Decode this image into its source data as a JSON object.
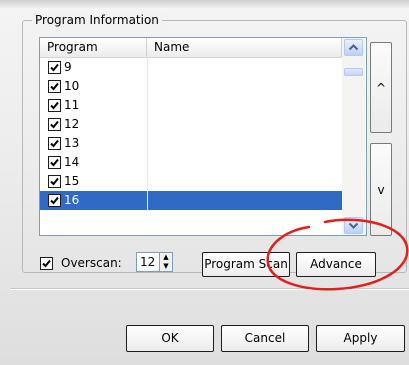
{
  "group": {
    "title": "Program Information"
  },
  "list": {
    "columns": [
      "Program",
      "Name"
    ],
    "rows": [
      {
        "program": "9",
        "name": "",
        "checked": true,
        "selected": false
      },
      {
        "program": "10",
        "name": "",
        "checked": true,
        "selected": false
      },
      {
        "program": "11",
        "name": "",
        "checked": true,
        "selected": false
      },
      {
        "program": "12",
        "name": "",
        "checked": true,
        "selected": false
      },
      {
        "program": "13",
        "name": "",
        "checked": true,
        "selected": false
      },
      {
        "program": "14",
        "name": "",
        "checked": true,
        "selected": false
      },
      {
        "program": "15",
        "name": "",
        "checked": true,
        "selected": false
      },
      {
        "program": "16",
        "name": "",
        "checked": true,
        "selected": true
      }
    ]
  },
  "side_buttons": {
    "up_label": "^",
    "down_label": "v"
  },
  "overscan": {
    "label": "Overscan:",
    "checked": true,
    "value": "12"
  },
  "buttons": {
    "program_scan": "Program Scan",
    "advance": "Advance",
    "ok": "OK",
    "cancel": "Cancel",
    "apply": "Apply"
  },
  "colors": {
    "selection": "#316ac5",
    "annotation": "#e0201b"
  }
}
